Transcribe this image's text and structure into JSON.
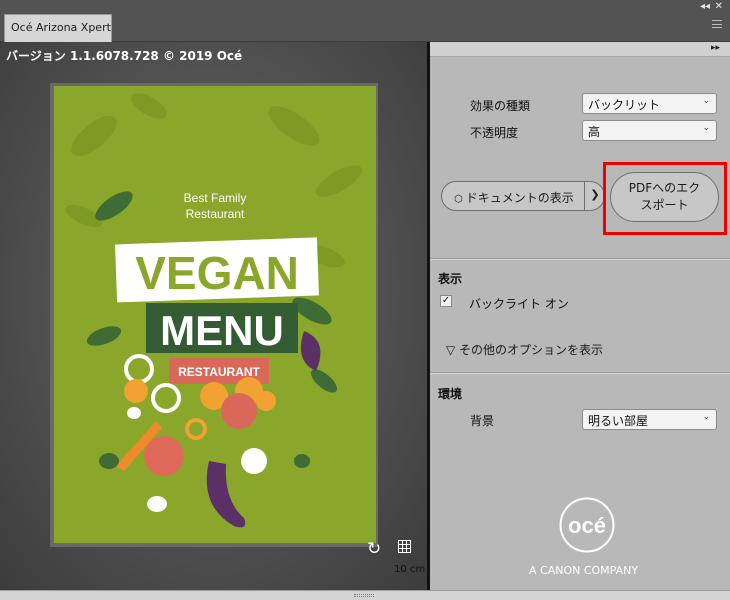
{
  "window": {
    "tab_title": "Océ Arizona Xpert",
    "ctl_collapse": "◂◂",
    "ctl_close": "✕"
  },
  "preview": {
    "version_text": "バージョン 1.1.6078.728 © 2019 Océ",
    "scale_label": "10 cm",
    "poster": {
      "tagline_1": "Best Family",
      "tagline_2": "Restaurant",
      "headline_1": "VEGAN",
      "headline_2": "MENU",
      "badge": "RESTAURANT"
    }
  },
  "settings": {
    "collapse_glyph": "▸▸",
    "effect_type_label": "効果の種類",
    "effect_type_value": "バックリット",
    "opacity_label": "不透明度",
    "opacity_value": "高",
    "show_document_button": "ドキュメントの表示",
    "export_pdf_line1": "PDFへのエク",
    "export_pdf_line2": "スポート",
    "display_section": "表示",
    "backlight_on_label": "バックライト オン",
    "backlight_checked": true,
    "more_options": "▽ その他のオプションを表示",
    "environment_section": "環境",
    "background_label": "背景",
    "background_value": "明るい部屋"
  },
  "brand": {
    "logo_text": "océ",
    "tagline": "A CANON COMPANY"
  },
  "colors": {
    "poster_green": "#8aa72c",
    "headline_green": "#8aa72c",
    "menu_dark_green": "#335c32",
    "badge_red": "#d8695a",
    "highlight_red": "#ec0000"
  }
}
